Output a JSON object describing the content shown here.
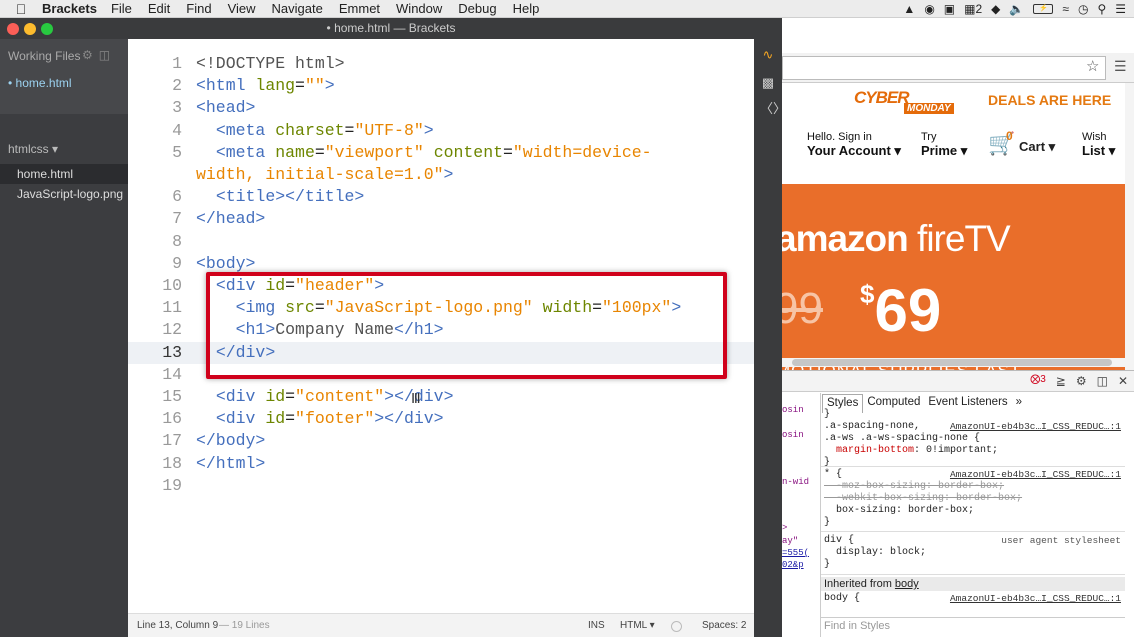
{
  "menubar": {
    "app": "Brackets",
    "items": [
      "File",
      "Edit",
      "Find",
      "View",
      "Navigate",
      "Emmet",
      "Window",
      "Debug",
      "Help"
    ],
    "status_badge": "2"
  },
  "window": {
    "title": "• home.html — Brackets"
  },
  "sidebar": {
    "working_files_header": "Working Files",
    "working_files": [
      "home.html"
    ],
    "project_name": "htmlcss ▾",
    "files": [
      "home.html",
      "JavaScript-logo.png"
    ]
  },
  "editor": {
    "lines": [
      {
        "n": "1",
        "html": "<span class=\"x\">&lt;!DOCTYPE html&gt;</span>"
      },
      {
        "n": "2",
        "html": "<span class=\"t\">&lt;html</span> <span class=\"a\">lang</span>=<span class=\"v\">\"\"</span><span class=\"t\">&gt;</span>"
      },
      {
        "n": "3",
        "html": "<span class=\"t\">&lt;head&gt;</span>"
      },
      {
        "n": "4",
        "html": "  <span class=\"t\">&lt;meta</span> <span class=\"a\">charset</span>=<span class=\"v\">\"UTF-8\"</span><span class=\"t\">&gt;</span>"
      },
      {
        "n": "5",
        "html": "  <span class=\"t\">&lt;meta</span> <span class=\"a\">name</span>=<span class=\"v\">\"viewport\"</span> <span class=\"a\">content</span>=<span class=\"v\">\"width=device-</span>"
      },
      {
        "n": "",
        "html": "<span class=\"v\">width, initial-scale=1.0\"</span><span class=\"t\">&gt;</span>"
      },
      {
        "n": "6",
        "html": "  <span class=\"t\">&lt;title&gt;&lt;/title&gt;</span>"
      },
      {
        "n": "7",
        "html": "<span class=\"t\">&lt;/head&gt;</span>"
      },
      {
        "n": "8",
        "html": ""
      },
      {
        "n": "9",
        "html": "<span class=\"t\">&lt;body&gt;</span>"
      },
      {
        "n": "10",
        "html": "  <span class=\"t\">&lt;div</span> <span class=\"a\">id</span>=<span class=\"v\">\"header\"</span><span class=\"t\">&gt;</span>"
      },
      {
        "n": "11",
        "html": "    <span class=\"t\">&lt;img</span> <span class=\"a\">src</span>=<span class=\"v\">\"JavaScript-logo.png\"</span> <span class=\"a\">width</span>=<span class=\"v\">\"100px\"</span><span class=\"t\">&gt;</span>"
      },
      {
        "n": "12",
        "html": "    <span class=\"t\">&lt;h1&gt;</span><span class=\"x\">Company Name</span><span class=\"t\">&lt;/h1&gt;</span>"
      },
      {
        "n": "13",
        "html": "  <span class=\"t\">&lt;/div&gt;</span>",
        "cur": true
      },
      {
        "n": "14",
        "html": ""
      },
      {
        "n": "15",
        "html": "  <span class=\"t\">&lt;div</span> <span class=\"a\">id</span>=<span class=\"v\">\"content\"</span><span class=\"t\">&gt;&lt;/div&gt;</span>"
      },
      {
        "n": "16",
        "html": "  <span class=\"t\">&lt;div</span> <span class=\"a\">id</span>=<span class=\"v\">\"footer\"</span><span class=\"t\">&gt;&lt;/div&gt;</span>"
      },
      {
        "n": "17",
        "html": "<span class=\"t\">&lt;/body&gt;</span>"
      },
      {
        "n": "18",
        "html": "<span class=\"t\">&lt;/html&gt;</span>"
      },
      {
        "n": "19",
        "html": ""
      }
    ]
  },
  "statusbar": {
    "position": "Line 13, Column 9",
    "lines": "— 19 Lines",
    "mode": "INS",
    "language": "HTML ▾",
    "spaces": "Spaces:  2"
  },
  "amazon": {
    "cyber": "CYBER",
    "monday": "MONDAY",
    "deals": "DEALS ARE HERE",
    "signin_small": "Hello. Sign in",
    "signin_big": "Your Account ▾",
    "prime_small": "Try",
    "prime_big": "Prime ▾",
    "cart_count": "0",
    "cart": "Cart ▾",
    "wish_small": "Wish",
    "wish_big": "List ▾",
    "fire_a": "amazon",
    "fire_b": "fireTV",
    "old_price": "99",
    "price_symbol": "$",
    "price": "69",
    "promo": "MOTIONAL SUPPLIES LAST"
  },
  "devtools": {
    "errors": "3",
    "tabs": [
      "Styles",
      "Computed",
      "Event Listeners",
      "»"
    ],
    "elements": [
      "osin",
      "osin",
      "n-wid",
      ">",
      "ay\" ",
      "=555(",
      "02&p"
    ],
    "src": "AmazonUI-eb4b3c…I_CSS_REDUC…:1",
    "rule1_sel": ".a-spacing-none,",
    "rule1_sel2": ".a-ws .a-ws-spacing-none {",
    "rule1_prop": "margin-bottom",
    "rule1_val": ": 0!important;",
    "rule2_sel": "* {",
    "rule2_p1": "-moz-box-sizing: border-box;",
    "rule2_p2": "-webkit-box-sizing: border-box;",
    "rule2_p3": "box-sizing: border-box;",
    "rule3_sel": "div {",
    "rule3_ua": "user agent stylesheet",
    "rule3_prop": "display: block;",
    "close": "}",
    "brace_top": "}",
    "inherited": "Inherited from ",
    "inherited_link": "body",
    "rule4_sel": "body {",
    "find": "Find in Styles"
  }
}
